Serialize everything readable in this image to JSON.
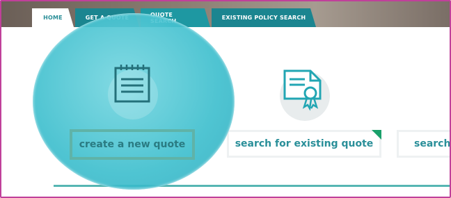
{
  "nav": {
    "tabs": [
      {
        "label": "HOME"
      },
      {
        "label": "GET A QUOTE"
      },
      {
        "label": "QUOTE SEARCH"
      },
      {
        "label": "EXISTING POLICY SEARCH"
      }
    ]
  },
  "cards": [
    {
      "label": "create a new quote",
      "icon": "notepad-icon"
    },
    {
      "label": "search for existing quote",
      "icon": "certificate-icon"
    },
    {
      "label": "search",
      "icon": "search-icon"
    }
  ],
  "colors": {
    "accent": "#1b8590",
    "highlight": "#5fd0dc",
    "border": "#c0409a"
  }
}
